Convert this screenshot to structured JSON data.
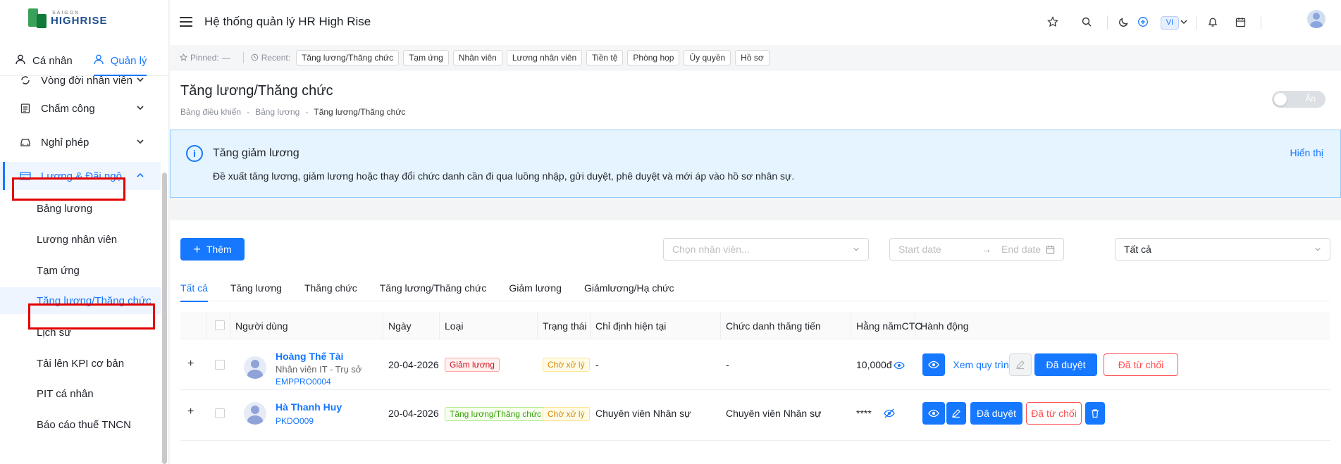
{
  "brand": {
    "small": "SAIGON",
    "big": "HIGHRISE"
  },
  "mode_tabs": [
    {
      "label": "Cá nhân",
      "icon": "person-icon"
    },
    {
      "label": "Quản lý",
      "icon": "person-icon"
    }
  ],
  "menu": {
    "items": [
      {
        "label": "Vòng đời nhân viên",
        "icon": "cycle-icon"
      },
      {
        "label": "Chấm công",
        "icon": "timesheet-icon"
      },
      {
        "label": "Nghỉ phép",
        "icon": "car-icon"
      },
      {
        "label": "Lương & Đãi ngộ",
        "icon": "salary-icon"
      }
    ],
    "sub_items": [
      "Bảng lương",
      "Lương nhân viên",
      "Tạm ứng",
      "Tăng lương/Thăng chức",
      "Lịch sử",
      "Tải lên KPI cơ bản",
      "PIT cá nhân",
      "Báo cáo thuế TNCN"
    ]
  },
  "header": {
    "title": "Hệ thống quản lý HR High Rise",
    "lang": "VI"
  },
  "recent_bar": {
    "pinned_label": "Pinned:",
    "pinned_value": "—",
    "recent_label": "Recent:",
    "chips": [
      "Tăng lương/Thăng chức",
      "Tạm ứng",
      "Nhân viên",
      "Lương nhân viên",
      "Tiền tệ",
      "Phòng họp",
      "Ủy quyền",
      "Hồ sơ"
    ]
  },
  "page": {
    "title": "Tăng lương/Thăng chức",
    "breadcrumb": [
      "Bảng điều khiển",
      "Bảng lương",
      "Tăng lương/Thăng chức"
    ],
    "breadcrumb_sep": "-",
    "toggle_label": "Ẩn"
  },
  "info": {
    "title": "Tăng giảm lương",
    "description": "Đề xuất tăng lương, giảm lương hoặc thay đổi chức danh cần đi qua luồng nhập, gửi duyệt, phê duyệt và mới áp vào hồ sơ nhân sự.",
    "link": "Hiển thị"
  },
  "toolbar": {
    "add_label": "Thêm",
    "employee_placeholder": "Chọn nhân viên...",
    "start_placeholder": "Start date",
    "end_placeholder": "End date",
    "status_value": "Tất cả"
  },
  "tabs": [
    "Tất cả",
    "Tăng lương",
    "Thăng chức",
    "Tăng lương/Thăng chức",
    "Giảm lương",
    "Giảmlương/Hạ chức"
  ],
  "table": {
    "columns": [
      "Người dùng",
      "Ngày",
      "Loại",
      "Trạng thái",
      "Chỉ định hiện tại",
      "Chức danh thăng tiến",
      "Hằng nămCTC",
      "Hành động"
    ],
    "rows": [
      {
        "name": "Hoàng Thế Tài",
        "subtitle": "Nhân viên IT - Trụ sở",
        "code": "EMPPRO0004",
        "date": "20-04-2026",
        "type": "Giảm lương",
        "status": "Chờ xử lý",
        "current": "-",
        "promotion": "-",
        "ctc": "10,000đ",
        "actions": {
          "flow": "Xem quy trình",
          "approve": "Đã duyệt",
          "reject": "Đã từ chối"
        }
      },
      {
        "name": "Hà Thanh Huy",
        "subtitle": "",
        "code": "PKDO009",
        "date": "20-04-2026",
        "type": "Tăng lương/Thăng chức",
        "status": "Chờ xử lý",
        "current": "Chuyên viên Nhân sự",
        "promotion": "Chuyên viên Nhân sự",
        "ctc": "****",
        "actions": {
          "approve": "Đã duyệt",
          "reject": "Đã từ chối"
        }
      }
    ],
    "expand_symbol": "+"
  },
  "colors": {
    "primary": "#1677ff",
    "highlight": "#e30000",
    "info_bg": "#e6f4ff"
  }
}
